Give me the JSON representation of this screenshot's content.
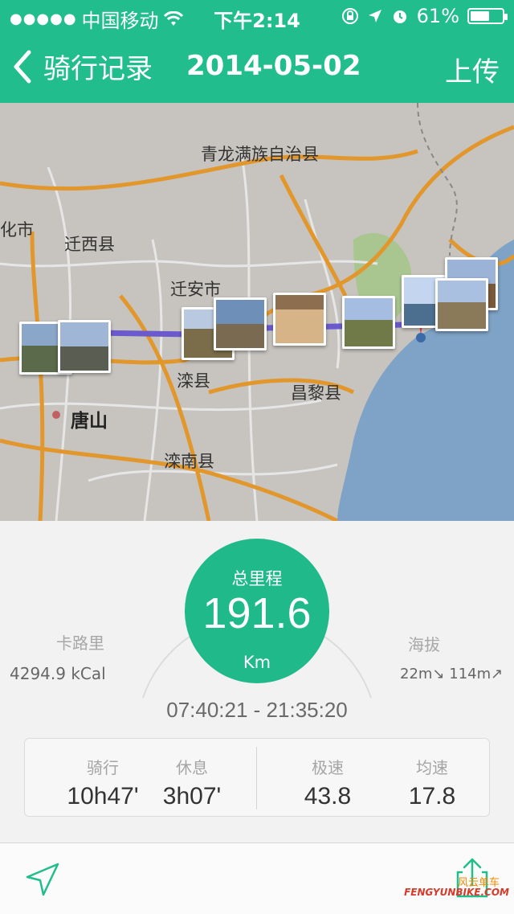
{
  "status_bar": {
    "carrier": "中国移动",
    "time": "下午2:14",
    "battery": "61%",
    "battery_level": 0.61,
    "icons": [
      "signal-dots-icon",
      "wifi-icon",
      "rotation-lock-icon",
      "location-arrow-icon",
      "alarm-icon",
      "battery-icon"
    ]
  },
  "nav": {
    "back_label": "骑行记录",
    "title": "2014-05-02",
    "upload_label": "上传"
  },
  "map": {
    "labels": [
      "青龙满族自治县",
      "化市",
      "迁西县",
      "迁安市",
      "滦县",
      "昌黎县",
      "唐山",
      "滦南县"
    ],
    "route_color": "#6a5acd",
    "water_color": "#7fa3c6",
    "land_color": "#c7c4bf",
    "green_color": "#a9c690",
    "photo_count": 9
  },
  "stats": {
    "total_label": "总里程",
    "total_value": "191.6",
    "total_unit": "Km",
    "calories_label": "卡路里",
    "calories_value": "4294.9 kCal",
    "altitude_label": "海拔",
    "altitude_value": "22m↘ 114m↗",
    "time_range": "07:40:21 - 21:35:20",
    "metrics": [
      {
        "label": "骑行",
        "value": "10h47'"
      },
      {
        "label": "休息",
        "value": "3h07'"
      },
      {
        "label": "极速",
        "value": "43.8"
      },
      {
        "label": "均速",
        "value": "17.8"
      }
    ],
    "accent": "#20b98a"
  },
  "bottom": {
    "brand_cn": "风云单车",
    "brand_en": "FENGYUNBIKE.COM"
  }
}
